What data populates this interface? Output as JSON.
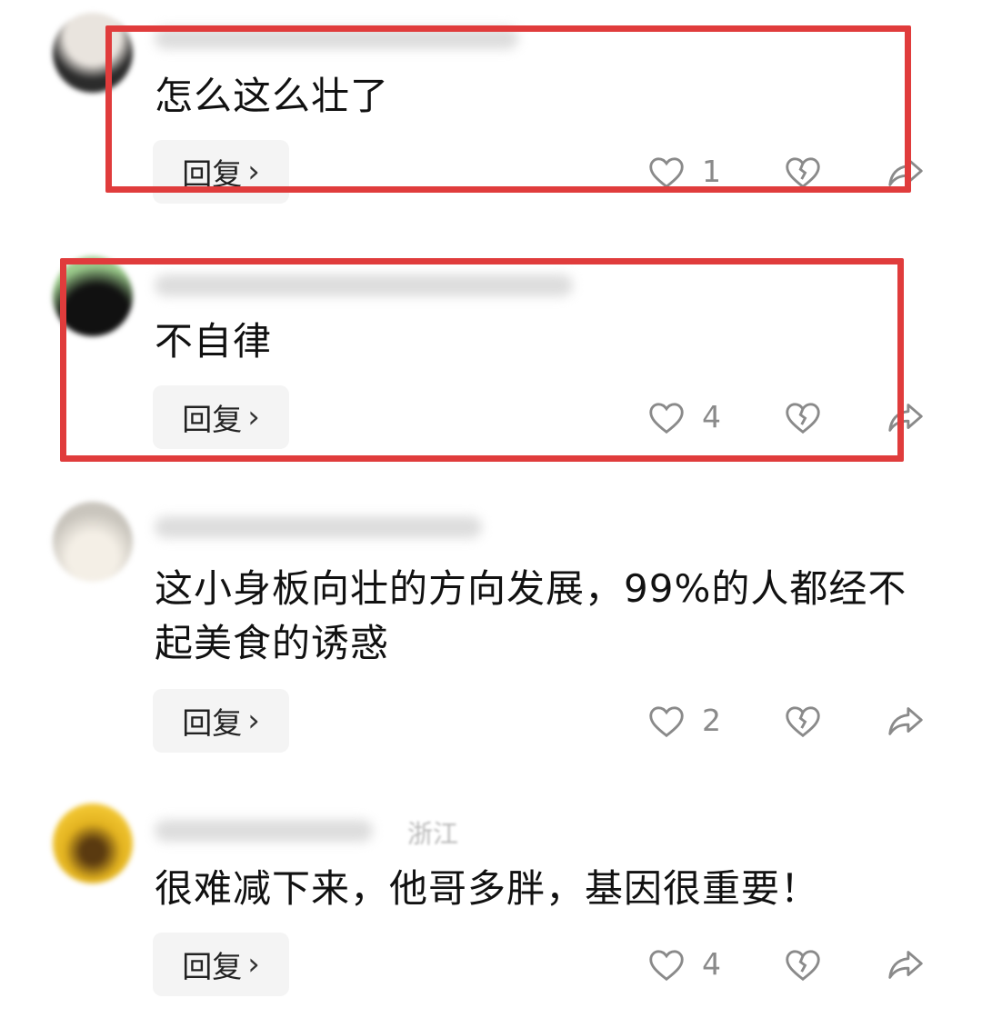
{
  "comments": [
    {
      "avatar_icon": "avatar",
      "username": "",
      "text": "怎么这么壮了",
      "reply_label": "回复",
      "likes": "1",
      "highlighted": true
    },
    {
      "avatar_icon": "avatar",
      "username": "",
      "text": "不自律",
      "reply_label": "回复",
      "likes": "4",
      "highlighted": true
    },
    {
      "avatar_icon": "avatar",
      "username": "",
      "text": "这小身板向壮的方向发展，99%的人都经不起美食的诱惑",
      "reply_label": "回复",
      "likes": "2",
      "highlighted": false
    },
    {
      "avatar_icon": "avatar",
      "username": "",
      "location": "浙江",
      "text": "很难减下来，他哥多胖，基因很重要！",
      "reply_label": "回复",
      "likes": "4",
      "highlighted": false
    }
  ],
  "icons": {
    "like": "heart-outline-icon",
    "dislike": "broken-heart-icon",
    "share": "share-arrow-icon",
    "chevron": "chevron-right-icon"
  },
  "colors": {
    "highlight_border": "#e03c3c",
    "reply_bg": "#f4f4f4",
    "icon_gray": "#8a8a8a",
    "text": "#111111"
  }
}
